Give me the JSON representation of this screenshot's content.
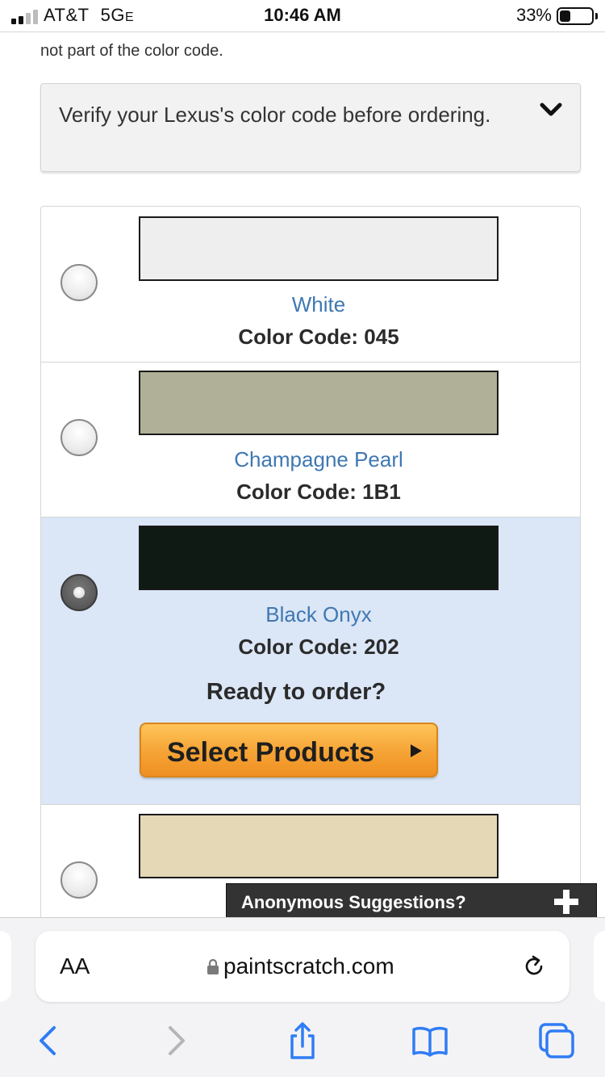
{
  "status_bar": {
    "carrier": "AT&T",
    "network_main": "5G",
    "network_suffix": "E",
    "time": "10:46 AM",
    "battery_percent": "33%",
    "battery_level": 0.33,
    "signal_bars_active": 2,
    "signal_bars_total": 4
  },
  "page": {
    "cut_note": "not part of the color code.",
    "verify_panel": {
      "text": "Verify your Lexus's color code before ordering.",
      "icon": "chevron-down-icon"
    },
    "colors": [
      {
        "name": "White",
        "code_label": "Color Code: 045",
        "swatch": "#eeeeee",
        "selected": false
      },
      {
        "name": "Champagne Pearl",
        "code_label": "Color Code: 1B1",
        "swatch": "#b0b098",
        "selected": false
      },
      {
        "name": "Black Onyx",
        "code_label": "Color Code: 202",
        "swatch": "#101a14",
        "selected": true
      },
      {
        "name": "",
        "code_label": "",
        "swatch": "#e4d8b6",
        "selected": false
      }
    ],
    "ready_prompt": "Ready to order?",
    "select_button": "Select Products",
    "suggestions_label": "Anonymous Suggestions?"
  },
  "browser": {
    "text_size_button": "AA",
    "url": "paintscratch.com",
    "icons": [
      "back-icon",
      "forward-icon",
      "share-icon",
      "bookmarks-icon",
      "tabs-icon",
      "reload-icon",
      "lock-icon"
    ]
  },
  "theme": {
    "link_blue": "#3f78b2",
    "selected_row": "#dbe6f6",
    "button_orange": "#f7a83a",
    "ios_blue": "#2f7cf6",
    "disabled_gray": "#b5b5b5"
  }
}
